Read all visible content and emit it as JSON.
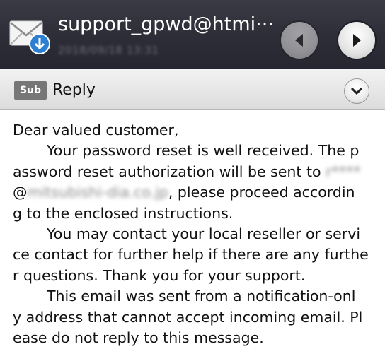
{
  "header": {
    "sender": "support_gpwd@htmi···",
    "date": "2018/09/18 13:31",
    "prev_icon": "chevron-left-icon",
    "next_icon": "chevron-right-icon",
    "mail_icon": "mail-download-icon"
  },
  "subject": {
    "badge": "Sub",
    "text": "Reply",
    "expand_icon": "chevron-down-icon"
  },
  "body": {
    "l1": "Dear valued customer,",
    "l2": "Your password reset is well received. The p",
    "l3a": "assword reset authorization will be sent to ",
    "l3b": "r****",
    "l4a": "@",
    "l4b": "mitsubishi-dia.co.jp",
    "l4c": ", please proceed accordin",
    "l5": "g to the enclosed instructions.",
    "l6": "You may contact your local reseller or servi",
    "l7": "ce contact for further help if there are any furthe",
    "l8": "r questions. Thank you for your support.",
    "l9": "This email was sent from a notification-onl",
    "l10": "y address that cannot accept incoming email. Pl",
    "l11": "ease do not reply to this message."
  }
}
